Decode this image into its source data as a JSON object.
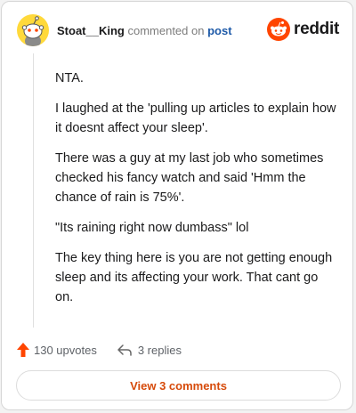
{
  "header": {
    "username": "Stoat__King",
    "action_text": "commented on",
    "post_link": "post",
    "brand_name": "reddit"
  },
  "comment": {
    "paragraphs": [
      "NTA.",
      "I laughed at the 'pulling up articles to explain how it doesnt affect your sleep'.",
      "There was a guy at my last job who sometimes checked his fancy watch and said 'Hmm the chance of rain is 75%'.",
      "\"Its raining right now dumbass\" lol",
      "The key thing here is you are not getting enough sleep and its affecting your work. That cant go on."
    ]
  },
  "actions": {
    "upvotes_label": "130 upvotes",
    "replies_label": "3 replies"
  },
  "footer": {
    "view_comments_label": "View 3 comments"
  },
  "colors": {
    "reddit_orange": "#ff4500",
    "link_blue": "#1e5aa8",
    "button_text": "#d64a0a",
    "avatar_yellow": "#ffd93b"
  },
  "icons": {
    "avatar": "snoo-avatar-icon",
    "brand": "reddit-logo-icon",
    "upvote": "upvote-arrow-icon",
    "reply": "reply-arrow-icon"
  }
}
